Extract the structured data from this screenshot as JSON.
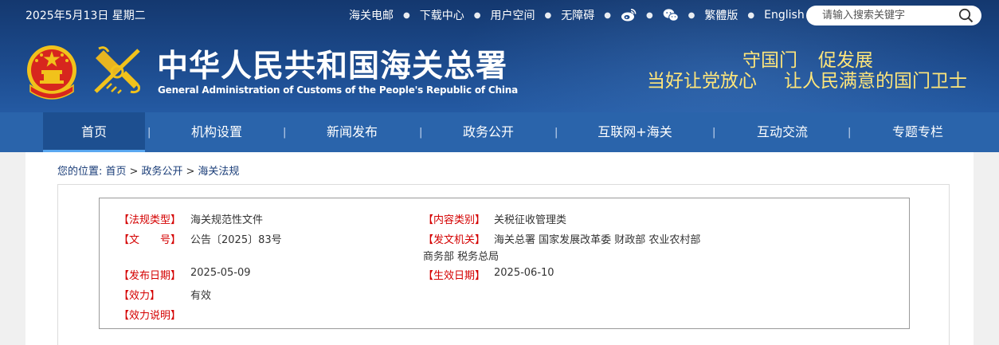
{
  "header": {
    "date": "2025年5月13日 星期二",
    "links": [
      "海关电邮",
      "下载中心",
      "用户空间",
      "无障碍"
    ],
    "traditional": "繁體版",
    "english": "English",
    "search_placeholder": "请输入搜索关键字",
    "title_cn": "中华人民共和国海关总署",
    "title_en": "General Administration of Customs of the People's Republic of China",
    "slogan_line1": [
      "守国门",
      "促发展"
    ],
    "slogan_line2": [
      "当好让党放心",
      "让人民满意的国门卫士"
    ]
  },
  "nav": {
    "separator": "|",
    "items": [
      "首页",
      "机构设置",
      "新闻发布",
      "政务公开",
      "互联网+海关",
      "互动交流",
      "专题专栏"
    ]
  },
  "breadcrumb": {
    "prefix": "您的位置:",
    "items": [
      "首页",
      "政务公开",
      "海关法规"
    ],
    "sep": ">"
  },
  "info": {
    "type_label": "【法规类型】",
    "type_value": "海关规范性文件",
    "category_label": "【内容类别】",
    "category_value": "关税征收管理类",
    "docno_label": "【文　　号】",
    "docno_value": "公告〔2025〕83号",
    "issuer_label": "【发文机关】",
    "issuer_value_line1": "海关总署 国家发展改革委 财政部 农业农村部",
    "issuer_value_line2": "商务部 税务总局",
    "publish_label": "【发布日期】",
    "publish_value": "2025-05-09",
    "effective_label": "【生效日期】",
    "effective_value": "2025-06-10",
    "validity_label": "【效力】",
    "validity_value": "有效",
    "note_label": "【效力说明】",
    "note_value": ""
  },
  "colors": {
    "header_bg": "#1c4a8c",
    "nav_bg": "#2a64ab",
    "nav_active": "#1d4f90",
    "slogan": "#ffe67a",
    "label_red": "#d40000"
  }
}
